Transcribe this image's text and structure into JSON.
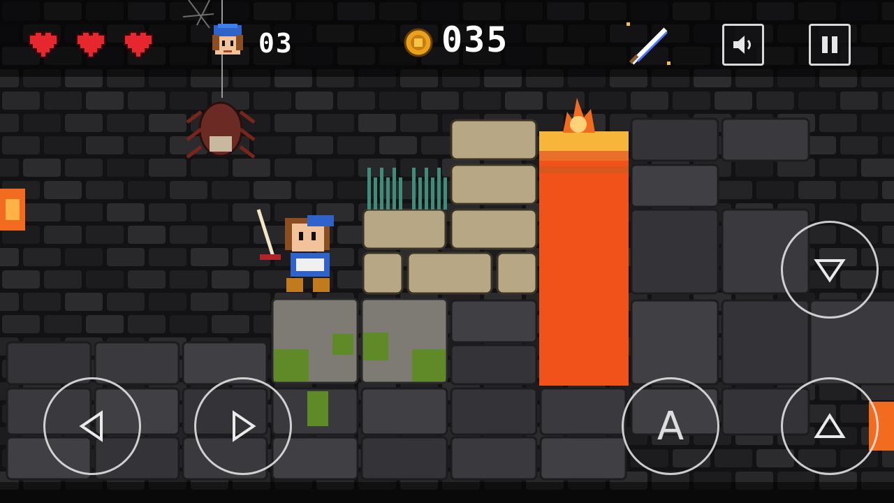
{
  "hud": {
    "hearts": 3,
    "lives_value": "03",
    "coins_value": "035",
    "icons": [
      "heart-icon",
      "player-head-icon",
      "coin-icon",
      "sword-icon",
      "speaker-icon",
      "pause-icon"
    ]
  },
  "controls": {
    "left": "left-arrow-icon",
    "right": "right-arrow-icon",
    "down": "down-arrow-icon",
    "up": "up-arrow-icon",
    "attack_label": "A"
  },
  "colors": {
    "heart": "#e8262e",
    "coin": "#e8a21c",
    "lava": "#f0521a",
    "lava_top": "#f7b53a",
    "stone": "#4a4a4f",
    "mossy_stone": "#7d7b73",
    "tan_block": "#b8a785",
    "moss": "#5f8a27"
  }
}
